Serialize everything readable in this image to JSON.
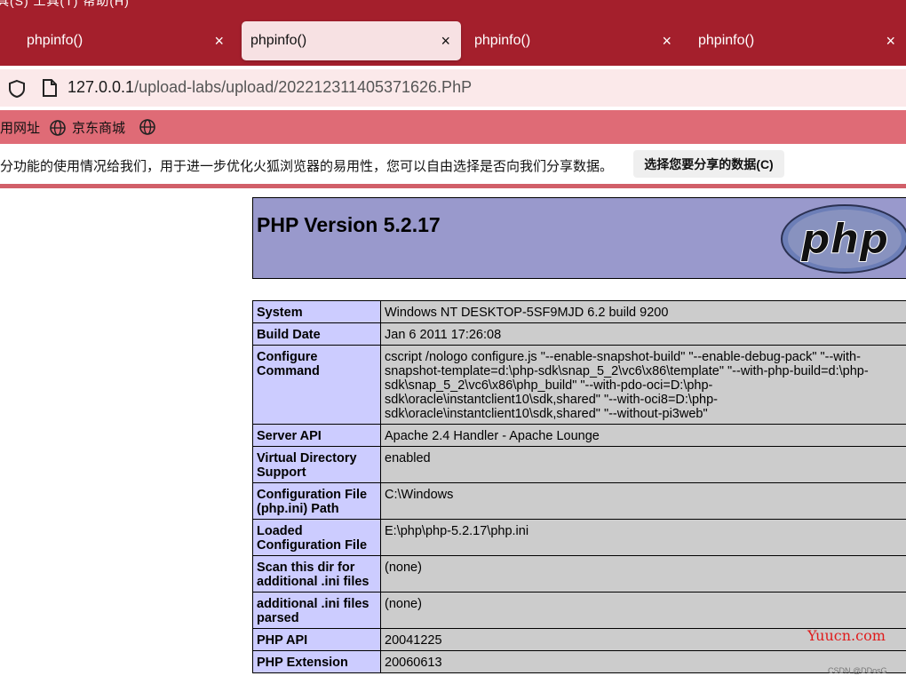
{
  "menu_partial": "具(S)   工具(T)   帮助(H)",
  "tabs": [
    {
      "title": "phpinfo()",
      "active": false
    },
    {
      "title": "phpinfo()",
      "active": true
    },
    {
      "title": "phpinfo()",
      "active": false
    },
    {
      "title": "phpinfo()",
      "active": false
    }
  ],
  "close_glyph": "×",
  "address": {
    "host": "127.0.0.1",
    "path": "/upload-labs/upload/202212311405371626.PhP"
  },
  "bookmarks": [
    {
      "label": "用网址"
    },
    {
      "label": "京东商城"
    },
    {
      "label": ""
    }
  ],
  "notice": {
    "text": "分功能的使用情况给我们，用于进一步优化火狐浏览器的易用性，您可以自由选择是否向我们分享数据。",
    "button": "选择您要分享的数据(C)"
  },
  "phpinfo": {
    "title": "PHP Version 5.2.17",
    "logo_text": "php",
    "rows": [
      {
        "key": "System",
        "value": "Windows NT DESKTOP-5SF9MJD 6.2 build 9200"
      },
      {
        "key": "Build Date",
        "value": "Jan 6 2011 17:26:08"
      },
      {
        "key": "Configure Command",
        "value": "cscript /nologo configure.js \"--enable-snapshot-build\" \"--enable-debug-pack\" \"--with-snapshot-template=d:\\php-sdk\\snap_5_2\\vc6\\x86\\template\" \"--with-php-build=d:\\php-sdk\\snap_5_2\\vc6\\x86\\php_build\" \"--with-pdo-oci=D:\\php-sdk\\oracle\\instantclient10\\sdk,shared\" \"--with-oci8=D:\\php-sdk\\oracle\\instantclient10\\sdk,shared\" \"--without-pi3web\""
      },
      {
        "key": "Server API",
        "value": "Apache 2.4 Handler - Apache Lounge"
      },
      {
        "key": "Virtual Directory Support",
        "value": "enabled"
      },
      {
        "key": "Configuration File (php.ini) Path",
        "value": "C:\\Windows"
      },
      {
        "key": "Loaded Configuration File",
        "value": "E:\\php\\php-5.2.17\\php.ini"
      },
      {
        "key": "Scan this dir for additional .ini files",
        "value": "(none)"
      },
      {
        "key": "additional .ini files parsed",
        "value": "(none)"
      },
      {
        "key": "PHP API",
        "value": "20041225"
      },
      {
        "key": "PHP Extension",
        "value": "20060613"
      }
    ]
  },
  "watermark": "Yuucn.com",
  "credit": "CSDN @DDosG",
  "colors": {
    "tabbar": "#a41f2c",
    "bookmarks": "#df6b76",
    "php_header": "#9999cc",
    "php_key": "#ccccff",
    "php_value": "#cccccc"
  }
}
